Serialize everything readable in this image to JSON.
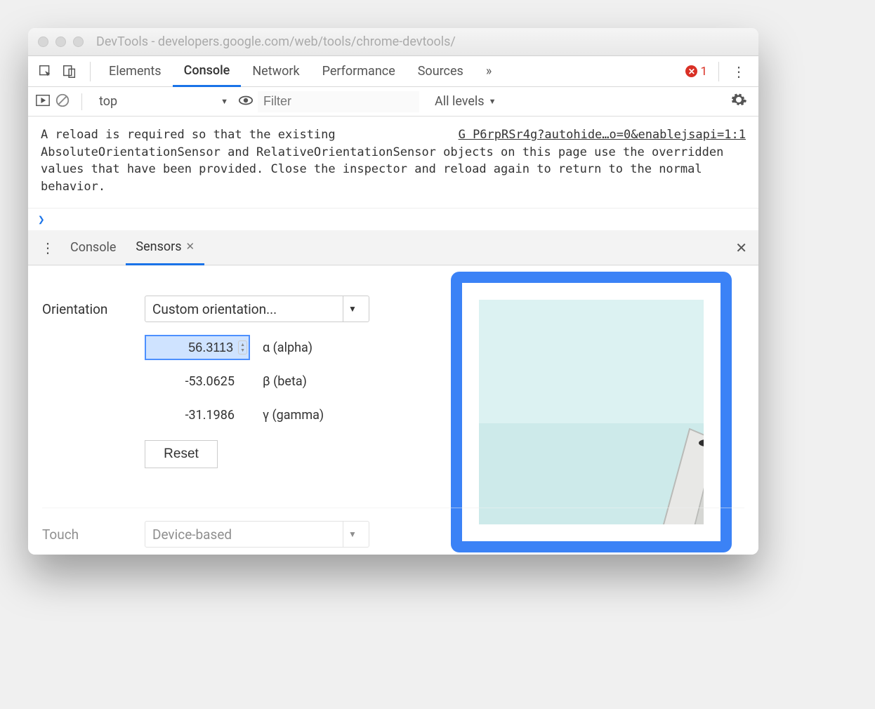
{
  "window": {
    "title": "DevTools - developers.google.com/web/tools/chrome-devtools/"
  },
  "toolbar": {
    "tabs": [
      "Elements",
      "Console",
      "Network",
      "Performance",
      "Sources"
    ],
    "active_tab": "Console",
    "more_glyph": "»",
    "error_count": "1"
  },
  "console_toolbar": {
    "context": "top",
    "filter_placeholder": "Filter",
    "levels_label": "All levels"
  },
  "console_message": {
    "text": "A reload is required so that the existing AbsoluteOrientationSensor and RelativeOrientationSensor objects on this page use the overridden values that have been provided. Close the inspector and reload again to return to the normal behavior.",
    "source": "G P6rpRSr4g?autohide…o=0&enablejsapi=1:1"
  },
  "drawer": {
    "tabs": [
      "Console",
      "Sensors"
    ],
    "active_tab": "Sensors"
  },
  "sensors": {
    "orientation_label": "Orientation",
    "orientation_select": "Custom orientation...",
    "alpha_val": "56.3113",
    "alpha_label": "α (alpha)",
    "beta_val": "-53.0625",
    "beta_label": "β (beta)",
    "gamma_val": "-31.1986",
    "gamma_label": "γ (gamma)",
    "reset_label": "Reset",
    "touch_label": "Touch",
    "touch_select": "Device-based"
  }
}
